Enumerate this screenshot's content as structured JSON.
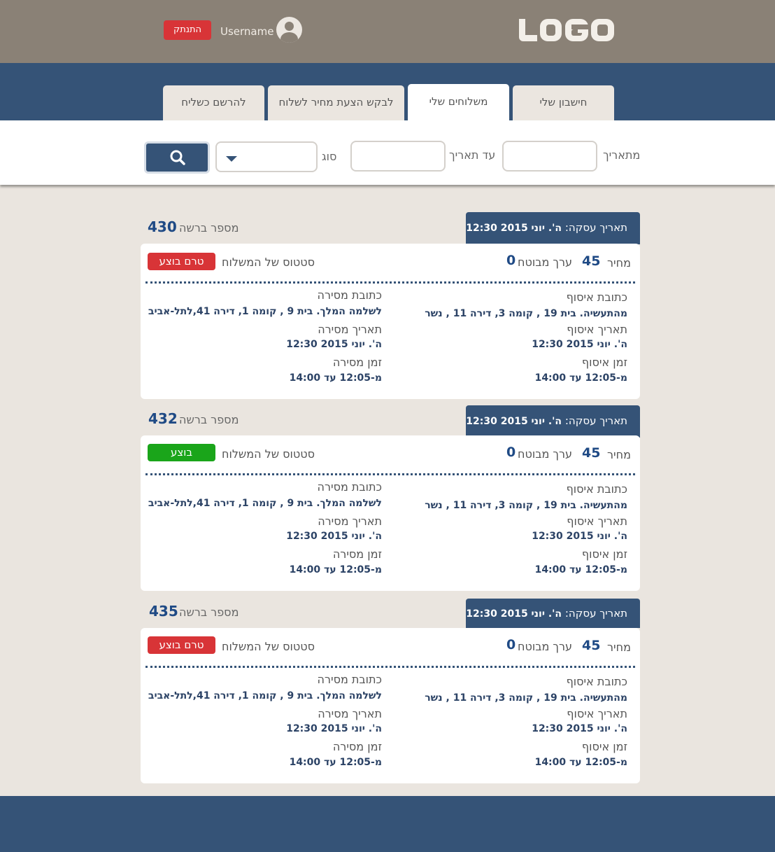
{
  "header": {
    "logo_text": "LOGO",
    "username": "Username",
    "logout_label": "התנתק"
  },
  "tabs": [
    {
      "label": "חישבון שלי",
      "active": false
    },
    {
      "label": "משלוחים שלי",
      "active": true
    },
    {
      "label": "לבקש הצעת מחיר לשלוח",
      "active": false
    },
    {
      "label": "להרשם כשליח",
      "active": false
    }
  ],
  "filters": {
    "from_date_label": "מתאריך",
    "from_date_value": "",
    "to_date_label": "עד תאריך",
    "to_date_value": "",
    "type_label": "סוג",
    "type_value": "",
    "search_icon": "search-icon"
  },
  "labels": {
    "deal_date": "תאריך עסקה:",
    "request_number": "מספר ברשה",
    "price": "מחיר",
    "insured_value": "ערך מבוטח",
    "delivery_status": "סטטוס של המשלוח",
    "pickup_address": "כתובת איסוף",
    "pickup_date": "תאריך איסוף",
    "pickup_time": "זמן איסוף",
    "delivery_address": "כתובת מסירה",
    "delivery_date": "תאריך מסירה",
    "delivery_time": "זמן מסירה"
  },
  "colors": {
    "status_pending": "#d83437",
    "status_done": "#1aa51a",
    "primary": "#355377"
  },
  "shipments": [
    {
      "deal_date": "ה'. יוני 2015 12:30",
      "request_number": "430",
      "price": "45",
      "insured_value": "0",
      "status": "טרם בוצע",
      "status_kind": "pending",
      "pickup_address": "מהתעשיה. בית 19 , קומה 3, דירה 11 , נשר",
      "pickup_date": "ה'. יוני 2015 12:30",
      "pickup_time": "מ-12:05 עד 14:00",
      "delivery_address": "לשלמה המלך. בית 9 , קומה 1, דירה 41,לתל-אביב",
      "delivery_date": "ה'. יוני 2015 12:30",
      "delivery_time": "מ-12:05 עד 14:00"
    },
    {
      "deal_date": "ה'. יוני 2015 12:30",
      "request_number": "432",
      "price": "45",
      "insured_value": "0",
      "status": "בוצע",
      "status_kind": "done",
      "pickup_address": "מהתעשיה. בית 19 , קומה 3, דירה 11 , נשר",
      "pickup_date": "ה'. יוני 2015 12:30",
      "pickup_time": "מ-12:05 עד 14:00",
      "delivery_address": "לשלמה המלך. בית 9 , קומה 1, דירה 41,לתל-אביב",
      "delivery_date": "ה'. יוני 2015 12:30",
      "delivery_time": "מ-12:05 עד 14:00"
    },
    {
      "deal_date": "ה'. יוני 2015 12:30",
      "request_number": "435",
      "price": "45",
      "insured_value": "0",
      "status": "טרם בוצע",
      "status_kind": "pending",
      "pickup_address": "מהתעשיה. בית 19 , קומה 3, דירה 11 , נשר",
      "pickup_date": "ה'. יוני 2015 12:30",
      "pickup_time": "מ-12:05 עד 14:00",
      "delivery_address": "לשלמה המלך. בית 9 , קומה 1, דירה 41,לתל-אביב",
      "delivery_date": "ה'. יוני 2015 12:30",
      "delivery_time": "מ-12:05 עד 14:00"
    }
  ]
}
